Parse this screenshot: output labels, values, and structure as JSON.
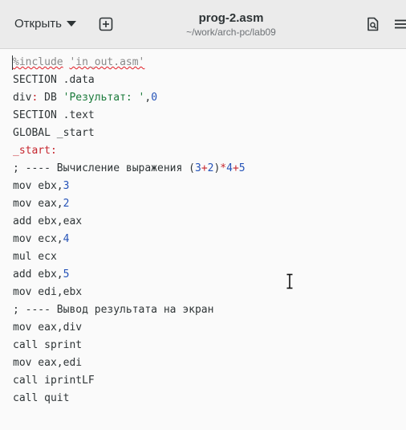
{
  "header": {
    "open_label": "Открыть",
    "title": "prog-2.asm",
    "subtitle": "~/work/arch-pc/lab09"
  },
  "icons": {
    "open_dropdown": "chevron-down-icon",
    "new_tab": "new-tab-plus-icon",
    "document": "document-search-icon",
    "menu": "hamburger-menu-icon"
  },
  "editor": {
    "lines": [
      "%include 'in_out.asm'",
      "SECTION .data",
      "div: DB 'Результат: ',0",
      "SECTION .text",
      "GLOBAL _start",
      "_start:",
      "; ---- Вычисление выражения (3+2)*4+5",
      "mov ebx,3",
      "mov eax,2",
      "add ebx,eax",
      "mov ecx,4",
      "mul ecx",
      "add ebx,5",
      "mov edi,ebx",
      "; ---- Вывод результата на экран",
      "mov eax,div",
      "call sprint",
      "mov eax,edi",
      "call iprintLF",
      "call quit"
    ]
  },
  "colors": {
    "string": "#1a7a3a",
    "number": "#2553b8",
    "label": "#c6262e",
    "spellcheck": "#e01b24"
  }
}
